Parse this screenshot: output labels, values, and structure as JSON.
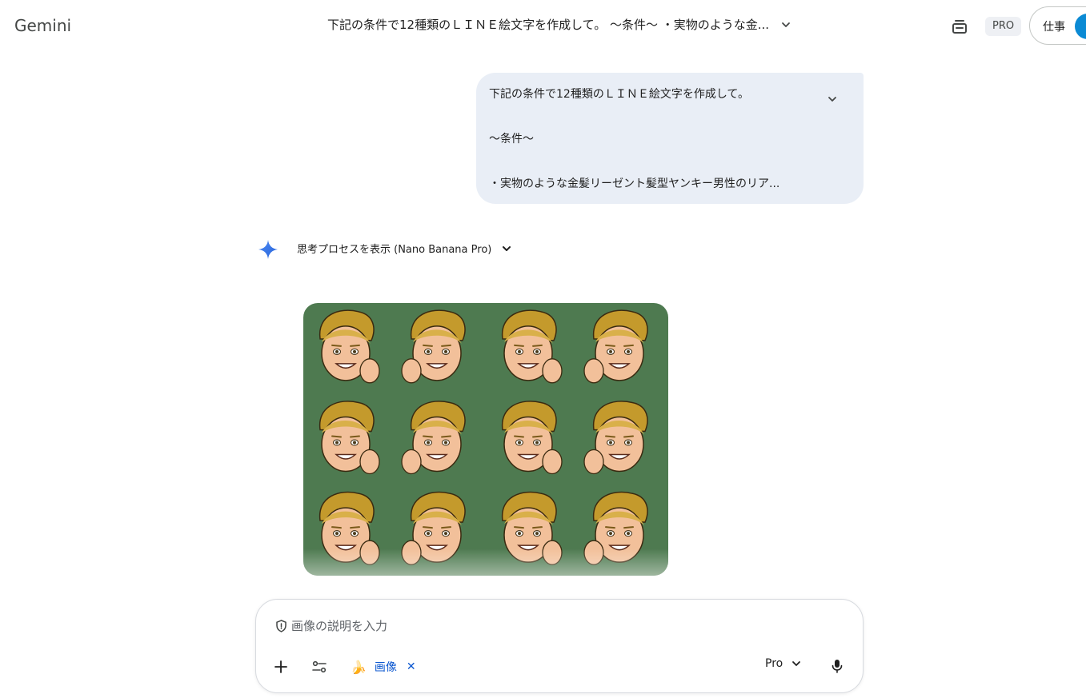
{
  "header": {
    "app_title": "Gemini",
    "conversation_title": "下記の条件で12種類のＬＩＮＥ絵文字を作成して。 〜条件〜 ・実物のような金...",
    "tier_badge": "PRO",
    "account_label": "仕事"
  },
  "user_message": {
    "lines": [
      "下記の条件で12種類のＬＩＮＥ絵文字を作成して。",
      "〜条件〜",
      "・実物のような金髪リーゼント髪型ヤンキー男性のリア..."
    ]
  },
  "response": {
    "thinking_label": "思考プロセスを表示 (Nano Banana Pro)"
  },
  "composer": {
    "placeholder": "画像の説明を入力",
    "chip_emoji": "🍌",
    "chip_label": "画像",
    "chip_close": "✕",
    "model_label": "Pro"
  },
  "icons": {
    "conv_chevron": "chevron-down-icon",
    "print": "print-icon",
    "spark": "gemini-spark-icon",
    "shield": "shield-icon",
    "add": "plus-icon",
    "tools": "tune-icon",
    "mic": "mic-icon"
  },
  "colors": {
    "bubble_bg": "#e9eef6",
    "image_bg": "#4e7a50",
    "chip_text": "#0b57d0",
    "avatar": "#0b8ad4"
  }
}
